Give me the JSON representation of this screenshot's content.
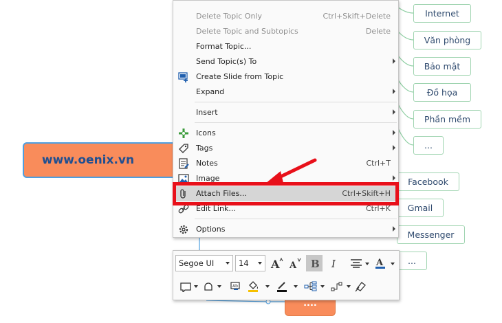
{
  "central_topic": {
    "label": "www.oenix.vn"
  },
  "subtopics_right": [
    "Internet",
    "Văn phòng",
    "Bảo mật",
    "Đồ họa",
    "Phần mềm",
    "..."
  ],
  "subtopics_right2": [
    "Facebook",
    "Gmail",
    "Messenger",
    "..."
  ],
  "bottom_topic": {
    "label": "...."
  },
  "context_menu": {
    "items": [
      {
        "label": "Delete Topic Only",
        "shortcut": "Ctrl+Skift+Delete",
        "disabled": true
      },
      {
        "label": "Delete Topic and Subtopics",
        "shortcut": "Delete",
        "disabled": true
      },
      {
        "label": "Format Topic..."
      },
      {
        "label": "Send Topic(s) To",
        "submenu": true
      },
      {
        "label": "Create Slide from Topic",
        "icon": "create-slide-icon"
      },
      {
        "label": "Expand",
        "submenu": true
      },
      {
        "label": "Insert",
        "submenu": true
      },
      {
        "label": "Icons",
        "submenu": true,
        "icon": "icons-icon"
      },
      {
        "label": "Tags",
        "submenu": true,
        "icon": "tag-icon"
      },
      {
        "label": "Notes",
        "shortcut": "Ctrl+T",
        "icon": "notes-icon"
      },
      {
        "label": "Image",
        "submenu": true,
        "icon": "image-icon"
      },
      {
        "label": "Attach Files...",
        "shortcut": "Ctrl+Skift+H",
        "icon": "paperclip-icon",
        "highlighted": true
      },
      {
        "label": "Edit Link...",
        "shortcut": "Ctrl+K",
        "icon": "link-icon"
      },
      {
        "label": "Options",
        "submenu": true,
        "icon": "gear-icon"
      }
    ]
  },
  "format_toolbar": {
    "font_family": "Segoe UI",
    "font_size": "14",
    "bold_active": true
  },
  "colors": {
    "central_fill": "#f98c5b",
    "central_border": "#4e9fe0",
    "central_text": "#1f4f91",
    "subtopic_border": "#9fd4b0",
    "connector": "#8fcfa3",
    "highlight_box": "#e8101a",
    "arrow": "#e8101a"
  }
}
